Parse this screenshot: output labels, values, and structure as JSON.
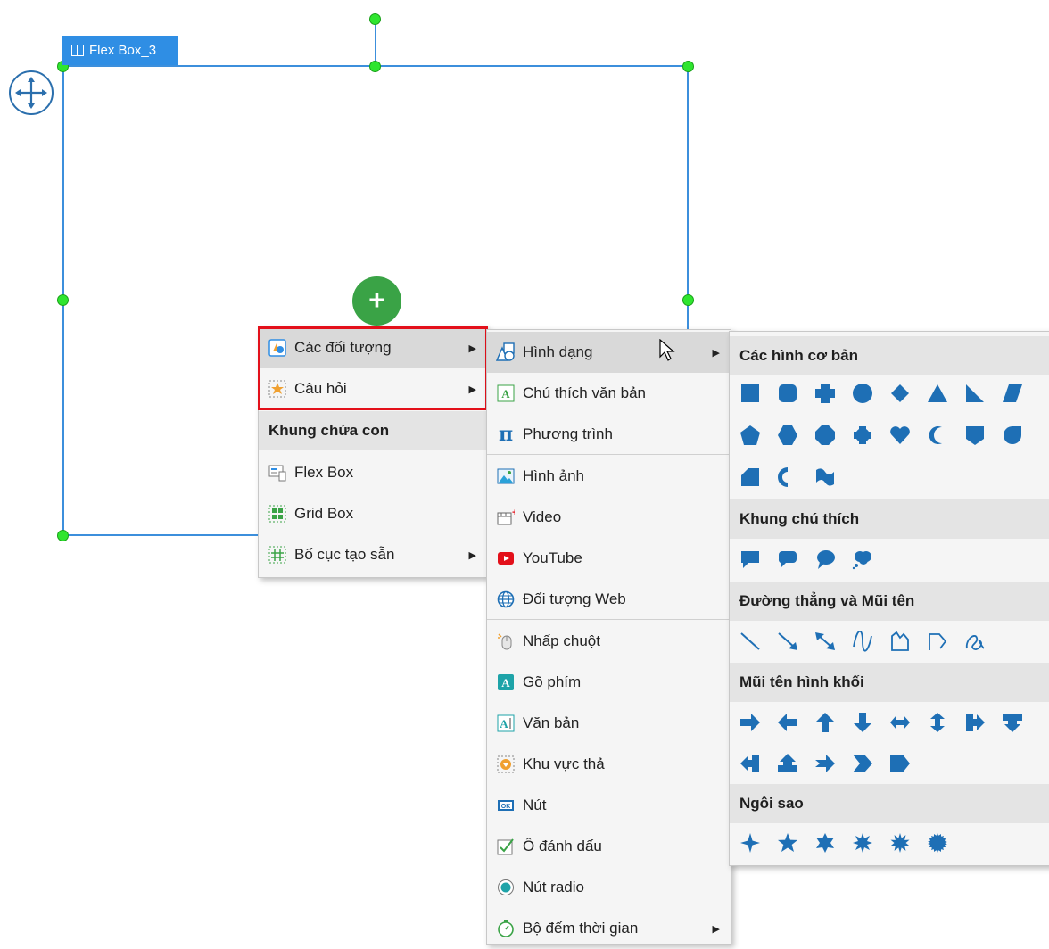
{
  "flexbox": {
    "label": "Flex Box_3",
    "add_symbol": "+"
  },
  "menu1": {
    "items": [
      {
        "label": "Các đối tượng",
        "icon": "objects-icon",
        "submenu": true,
        "highlighted": true
      },
      {
        "label": "Câu hỏi",
        "icon": "question-icon",
        "submenu": true
      }
    ],
    "section": "Khung chứa con",
    "containers": [
      {
        "label": "Flex Box",
        "icon": "flexbox-icon"
      },
      {
        "label": "Grid Box",
        "icon": "gridbox-icon"
      },
      {
        "label": "Bố cục tạo sẵn",
        "icon": "layout-icon",
        "submenu": true
      }
    ]
  },
  "menu2": {
    "items": [
      {
        "label": "Hình dạng",
        "icon": "shapes-icon",
        "submenu": true,
        "highlighted": true
      },
      {
        "label": "Chú thích văn bản",
        "icon": "text-caption-icon"
      },
      {
        "label": "Phương trình",
        "icon": "pi-icon"
      },
      {
        "label": "Hình ảnh",
        "icon": "image-icon"
      },
      {
        "label": "Video",
        "icon": "video-icon"
      },
      {
        "label": "YouTube",
        "icon": "youtube-icon"
      },
      {
        "label": "Đối tượng Web",
        "icon": "globe-icon"
      },
      {
        "label": "Nhấp chuột",
        "icon": "mouse-icon"
      },
      {
        "label": "Gõ phím",
        "icon": "typing-icon"
      },
      {
        "label": "Văn bản",
        "icon": "text-input-icon"
      },
      {
        "label": "Khu vực thả",
        "icon": "drop-zone-icon"
      },
      {
        "label": "Nút",
        "icon": "button-icon"
      },
      {
        "label": "Ô đánh dấu",
        "icon": "checkbox-icon"
      },
      {
        "label": "Nút radio",
        "icon": "radio-icon"
      },
      {
        "label": "Bộ đếm thời gian",
        "icon": "timer-icon",
        "submenu": true
      }
    ]
  },
  "menu3": {
    "sections": [
      {
        "title": "Các hình cơ bản"
      },
      {
        "title": "Khung chú thích"
      },
      {
        "title": "Đường thẳng và Mũi tên"
      },
      {
        "title": "Mũi tên hình khối"
      },
      {
        "title": "Ngôi sao"
      }
    ]
  },
  "colors": {
    "accent": "#2f8ee4",
    "shape": "#1e6fb5",
    "handle": "#2fe52f",
    "add": "#3aa346",
    "red_outline": "#e3101a"
  }
}
